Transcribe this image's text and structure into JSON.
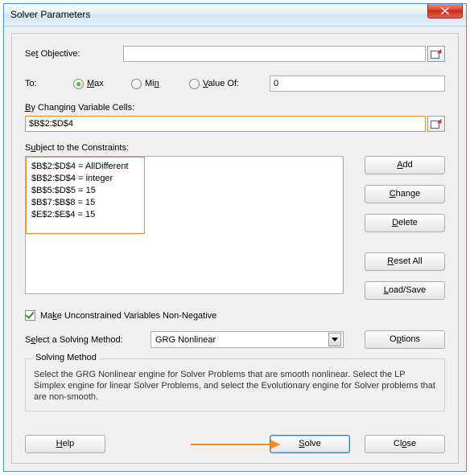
{
  "window": {
    "title": "Solver Parameters"
  },
  "objective": {
    "label_pre": "Se",
    "label_u": "t",
    "label_post": " Objective:",
    "value": ""
  },
  "to": {
    "label": "To:",
    "max_u": "M",
    "max_post": "ax",
    "min_pre": "Mi",
    "min_u": "n",
    "valof_u": "V",
    "valof_post": "alue Of:",
    "value_of_input": "0"
  },
  "changing": {
    "label_u": "B",
    "label_post": "y Changing Variable Cells:",
    "value": "$B$2:$D$4"
  },
  "constraints": {
    "label_pre": "S",
    "label_u": "u",
    "label_post": "bject to the Constraints:",
    "lines": [
      "$B$2:$D$4 = AllDifferent",
      "$B$2:$D$4 = integer",
      "$B$5:$D$5 = 15",
      "$B$7:$B$8 = 15",
      "$E$2:$E$4 = 15"
    ]
  },
  "buttons": {
    "add_u": "A",
    "add_post": "dd",
    "change_u": "C",
    "change_post": "hange",
    "delete_u": "D",
    "delete_post": "elete",
    "reset_u": "R",
    "reset_post": "eset All",
    "load_u": "L",
    "load_post": "oad/Save",
    "options_pre": "O",
    "options_u": "p",
    "options_post": "tions",
    "help_u": "H",
    "help_post": "elp",
    "solve_u": "S",
    "solve_post": "olve",
    "close_pre": "Cl",
    "close_u": "o",
    "close_post": "se"
  },
  "nonneg": {
    "pre": "Ma",
    "u": "k",
    "post": "e Unconstrained Variables Non-Negative"
  },
  "method": {
    "label_pre": "S",
    "label_u": "e",
    "label_post": "lect a Solving Method:",
    "value": "GRG Nonlinear",
    "group_label": "Solving Method",
    "description": "Select the GRG Nonlinear engine for Solver Problems that are smooth nonlinear. Select the LP Simplex engine for linear Solver Problems, and select the Evolutionary engine for Solver problems that are non-smooth."
  }
}
